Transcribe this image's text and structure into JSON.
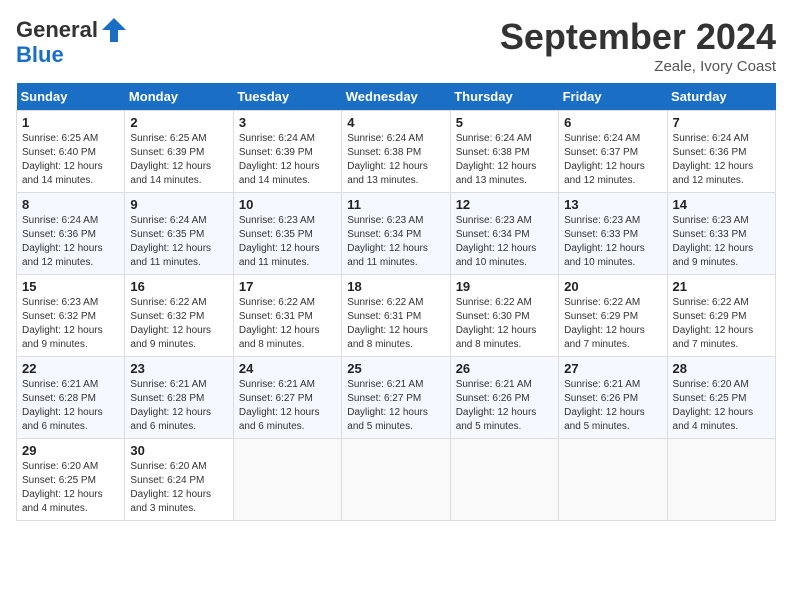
{
  "logo": {
    "text_general": "General",
    "text_blue": "Blue"
  },
  "header": {
    "month_title": "September 2024",
    "location": "Zeale, Ivory Coast"
  },
  "weekdays": [
    "Sunday",
    "Monday",
    "Tuesday",
    "Wednesday",
    "Thursday",
    "Friday",
    "Saturday"
  ],
  "weeks": [
    [
      {
        "day": "1",
        "sunrise": "6:25 AM",
        "sunset": "6:40 PM",
        "daylight": "12 hours and 14 minutes."
      },
      {
        "day": "2",
        "sunrise": "6:25 AM",
        "sunset": "6:39 PM",
        "daylight": "12 hours and 14 minutes."
      },
      {
        "day": "3",
        "sunrise": "6:24 AM",
        "sunset": "6:39 PM",
        "daylight": "12 hours and 14 minutes."
      },
      {
        "day": "4",
        "sunrise": "6:24 AM",
        "sunset": "6:38 PM",
        "daylight": "12 hours and 13 minutes."
      },
      {
        "day": "5",
        "sunrise": "6:24 AM",
        "sunset": "6:38 PM",
        "daylight": "12 hours and 13 minutes."
      },
      {
        "day": "6",
        "sunrise": "6:24 AM",
        "sunset": "6:37 PM",
        "daylight": "12 hours and 12 minutes."
      },
      {
        "day": "7",
        "sunrise": "6:24 AM",
        "sunset": "6:36 PM",
        "daylight": "12 hours and 12 minutes."
      }
    ],
    [
      {
        "day": "8",
        "sunrise": "6:24 AM",
        "sunset": "6:36 PM",
        "daylight": "12 hours and 12 minutes."
      },
      {
        "day": "9",
        "sunrise": "6:24 AM",
        "sunset": "6:35 PM",
        "daylight": "12 hours and 11 minutes."
      },
      {
        "day": "10",
        "sunrise": "6:23 AM",
        "sunset": "6:35 PM",
        "daylight": "12 hours and 11 minutes."
      },
      {
        "day": "11",
        "sunrise": "6:23 AM",
        "sunset": "6:34 PM",
        "daylight": "12 hours and 11 minutes."
      },
      {
        "day": "12",
        "sunrise": "6:23 AM",
        "sunset": "6:34 PM",
        "daylight": "12 hours and 10 minutes."
      },
      {
        "day": "13",
        "sunrise": "6:23 AM",
        "sunset": "6:33 PM",
        "daylight": "12 hours and 10 minutes."
      },
      {
        "day": "14",
        "sunrise": "6:23 AM",
        "sunset": "6:33 PM",
        "daylight": "12 hours and 9 minutes."
      }
    ],
    [
      {
        "day": "15",
        "sunrise": "6:23 AM",
        "sunset": "6:32 PM",
        "daylight": "12 hours and 9 minutes."
      },
      {
        "day": "16",
        "sunrise": "6:22 AM",
        "sunset": "6:32 PM",
        "daylight": "12 hours and 9 minutes."
      },
      {
        "day": "17",
        "sunrise": "6:22 AM",
        "sunset": "6:31 PM",
        "daylight": "12 hours and 8 minutes."
      },
      {
        "day": "18",
        "sunrise": "6:22 AM",
        "sunset": "6:31 PM",
        "daylight": "12 hours and 8 minutes."
      },
      {
        "day": "19",
        "sunrise": "6:22 AM",
        "sunset": "6:30 PM",
        "daylight": "12 hours and 8 minutes."
      },
      {
        "day": "20",
        "sunrise": "6:22 AM",
        "sunset": "6:29 PM",
        "daylight": "12 hours and 7 minutes."
      },
      {
        "day": "21",
        "sunrise": "6:22 AM",
        "sunset": "6:29 PM",
        "daylight": "12 hours and 7 minutes."
      }
    ],
    [
      {
        "day": "22",
        "sunrise": "6:21 AM",
        "sunset": "6:28 PM",
        "daylight": "12 hours and 6 minutes."
      },
      {
        "day": "23",
        "sunrise": "6:21 AM",
        "sunset": "6:28 PM",
        "daylight": "12 hours and 6 minutes."
      },
      {
        "day": "24",
        "sunrise": "6:21 AM",
        "sunset": "6:27 PM",
        "daylight": "12 hours and 6 minutes."
      },
      {
        "day": "25",
        "sunrise": "6:21 AM",
        "sunset": "6:27 PM",
        "daylight": "12 hours and 5 minutes."
      },
      {
        "day": "26",
        "sunrise": "6:21 AM",
        "sunset": "6:26 PM",
        "daylight": "12 hours and 5 minutes."
      },
      {
        "day": "27",
        "sunrise": "6:21 AM",
        "sunset": "6:26 PM",
        "daylight": "12 hours and 5 minutes."
      },
      {
        "day": "28",
        "sunrise": "6:20 AM",
        "sunset": "6:25 PM",
        "daylight": "12 hours and 4 minutes."
      }
    ],
    [
      {
        "day": "29",
        "sunrise": "6:20 AM",
        "sunset": "6:25 PM",
        "daylight": "12 hours and 4 minutes."
      },
      {
        "day": "30",
        "sunrise": "6:20 AM",
        "sunset": "6:24 PM",
        "daylight": "12 hours and 3 minutes."
      },
      null,
      null,
      null,
      null,
      null
    ]
  ]
}
